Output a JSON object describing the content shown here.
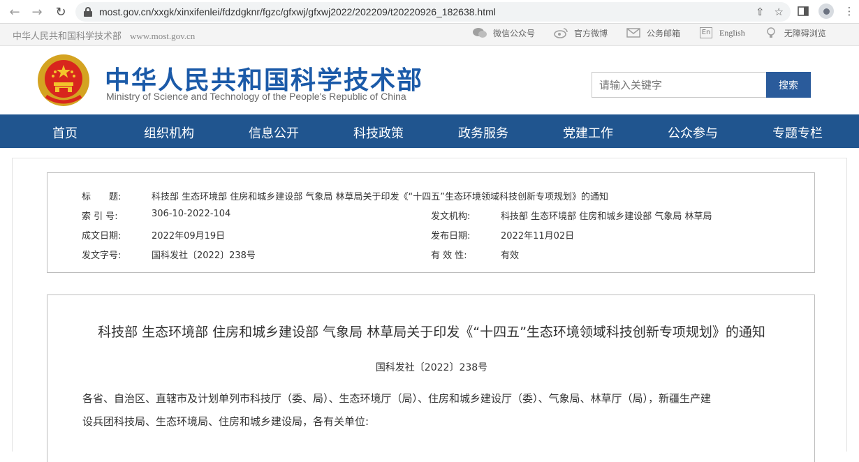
{
  "browser": {
    "url": "most.gov.cn/xxgk/xinxifenlei/fdzdgknr/fgzc/gfxwj/gfxwj2022/202209/t20220926_182638.html"
  },
  "topbar": {
    "site_name": "中华人民共和国科学技术部",
    "site_url": "www.most.gov.cn",
    "links": [
      {
        "label": "微信公众号",
        "icon": "wechat-icon"
      },
      {
        "label": "官方微博",
        "icon": "weibo-icon"
      },
      {
        "label": "公务邮箱",
        "icon": "mail-icon"
      },
      {
        "label": "English",
        "icon": "english-icon"
      },
      {
        "label": "无障碍浏览",
        "icon": "accessibility-icon"
      }
    ]
  },
  "header": {
    "title_cn": "中华人民共和国科学技术部",
    "title_en": "Ministry of Science and Technology of the People's Republic of China",
    "search_placeholder": "请输入关键字",
    "search_button": "搜索"
  },
  "nav": [
    "首页",
    "组织机构",
    "信息公开",
    "科技政策",
    "政务服务",
    "党建工作",
    "公众参与",
    "专题专栏"
  ],
  "meta": {
    "title_label": "标　　题:",
    "title_value": "科技部 生态环境部 住房和城乡建设部 气象局 林草局关于印发《“十四五”生态环境领域科技创新专项规划》的通知",
    "index_label": "索 引 号:",
    "index_value": "306-10-2022-104",
    "issuer_label": "发文机构:",
    "issuer_value": "科技部 生态环境部 住房和城乡建设部 气象局 林草局",
    "created_label": "成文日期:",
    "created_value": "2022年09月19日",
    "published_label": "发布日期:",
    "published_value": "2022年11月02日",
    "docno_label": "发文字号:",
    "docno_value": "国科发社〔2022〕238号",
    "validity_label": "有 效 性:",
    "validity_value": "有效"
  },
  "article": {
    "title": "科技部 生态环境部 住房和城乡建设部 气象局 林草局关于印发《“十四五”生态环境领域科技创新专项规划》的通知",
    "doc_number": "国科发社〔2022〕238号",
    "body_line1": "各省、自治区、直辖市及计划单列市科技厅（委、局）、生态环境厅（局）、住房和城乡建设厅（委）、气象局、林草厅（局），新疆生产建",
    "body_line2": "设兵团科技局、生态环境局、住房和城乡建设局，各有关单位:"
  }
}
